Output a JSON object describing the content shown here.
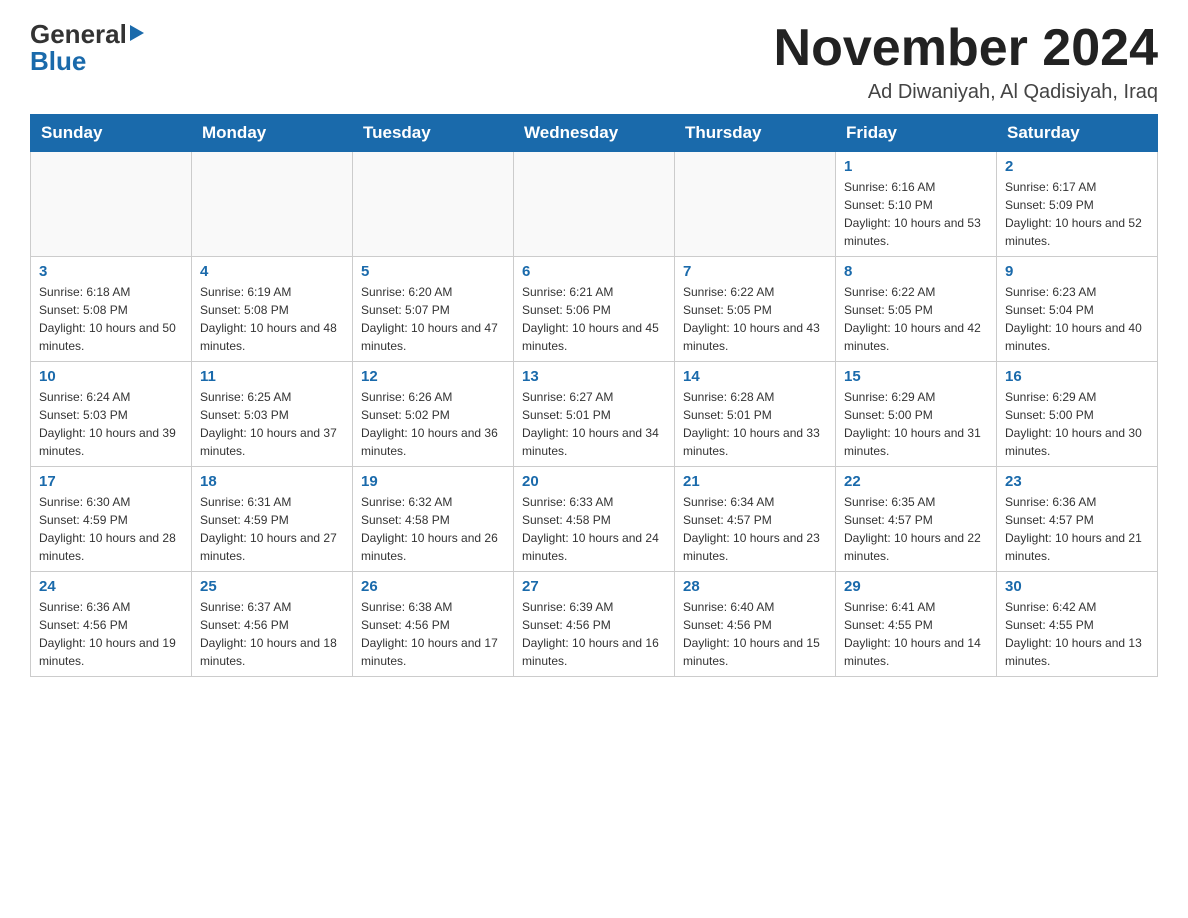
{
  "logo": {
    "general": "General",
    "blue": "Blue",
    "arrow": "▶"
  },
  "title": "November 2024",
  "location": "Ad Diwaniyah, Al Qadisiyah, Iraq",
  "days_of_week": [
    "Sunday",
    "Monday",
    "Tuesday",
    "Wednesday",
    "Thursday",
    "Friday",
    "Saturday"
  ],
  "weeks": [
    [
      {
        "day": "",
        "info": ""
      },
      {
        "day": "",
        "info": ""
      },
      {
        "day": "",
        "info": ""
      },
      {
        "day": "",
        "info": ""
      },
      {
        "day": "",
        "info": ""
      },
      {
        "day": "1",
        "info": "Sunrise: 6:16 AM\nSunset: 5:10 PM\nDaylight: 10 hours and 53 minutes."
      },
      {
        "day": "2",
        "info": "Sunrise: 6:17 AM\nSunset: 5:09 PM\nDaylight: 10 hours and 52 minutes."
      }
    ],
    [
      {
        "day": "3",
        "info": "Sunrise: 6:18 AM\nSunset: 5:08 PM\nDaylight: 10 hours and 50 minutes."
      },
      {
        "day": "4",
        "info": "Sunrise: 6:19 AM\nSunset: 5:08 PM\nDaylight: 10 hours and 48 minutes."
      },
      {
        "day": "5",
        "info": "Sunrise: 6:20 AM\nSunset: 5:07 PM\nDaylight: 10 hours and 47 minutes."
      },
      {
        "day": "6",
        "info": "Sunrise: 6:21 AM\nSunset: 5:06 PM\nDaylight: 10 hours and 45 minutes."
      },
      {
        "day": "7",
        "info": "Sunrise: 6:22 AM\nSunset: 5:05 PM\nDaylight: 10 hours and 43 minutes."
      },
      {
        "day": "8",
        "info": "Sunrise: 6:22 AM\nSunset: 5:05 PM\nDaylight: 10 hours and 42 minutes."
      },
      {
        "day": "9",
        "info": "Sunrise: 6:23 AM\nSunset: 5:04 PM\nDaylight: 10 hours and 40 minutes."
      }
    ],
    [
      {
        "day": "10",
        "info": "Sunrise: 6:24 AM\nSunset: 5:03 PM\nDaylight: 10 hours and 39 minutes."
      },
      {
        "day": "11",
        "info": "Sunrise: 6:25 AM\nSunset: 5:03 PM\nDaylight: 10 hours and 37 minutes."
      },
      {
        "day": "12",
        "info": "Sunrise: 6:26 AM\nSunset: 5:02 PM\nDaylight: 10 hours and 36 minutes."
      },
      {
        "day": "13",
        "info": "Sunrise: 6:27 AM\nSunset: 5:01 PM\nDaylight: 10 hours and 34 minutes."
      },
      {
        "day": "14",
        "info": "Sunrise: 6:28 AM\nSunset: 5:01 PM\nDaylight: 10 hours and 33 minutes."
      },
      {
        "day": "15",
        "info": "Sunrise: 6:29 AM\nSunset: 5:00 PM\nDaylight: 10 hours and 31 minutes."
      },
      {
        "day": "16",
        "info": "Sunrise: 6:29 AM\nSunset: 5:00 PM\nDaylight: 10 hours and 30 minutes."
      }
    ],
    [
      {
        "day": "17",
        "info": "Sunrise: 6:30 AM\nSunset: 4:59 PM\nDaylight: 10 hours and 28 minutes."
      },
      {
        "day": "18",
        "info": "Sunrise: 6:31 AM\nSunset: 4:59 PM\nDaylight: 10 hours and 27 minutes."
      },
      {
        "day": "19",
        "info": "Sunrise: 6:32 AM\nSunset: 4:58 PM\nDaylight: 10 hours and 26 minutes."
      },
      {
        "day": "20",
        "info": "Sunrise: 6:33 AM\nSunset: 4:58 PM\nDaylight: 10 hours and 24 minutes."
      },
      {
        "day": "21",
        "info": "Sunrise: 6:34 AM\nSunset: 4:57 PM\nDaylight: 10 hours and 23 minutes."
      },
      {
        "day": "22",
        "info": "Sunrise: 6:35 AM\nSunset: 4:57 PM\nDaylight: 10 hours and 22 minutes."
      },
      {
        "day": "23",
        "info": "Sunrise: 6:36 AM\nSunset: 4:57 PM\nDaylight: 10 hours and 21 minutes."
      }
    ],
    [
      {
        "day": "24",
        "info": "Sunrise: 6:36 AM\nSunset: 4:56 PM\nDaylight: 10 hours and 19 minutes."
      },
      {
        "day": "25",
        "info": "Sunrise: 6:37 AM\nSunset: 4:56 PM\nDaylight: 10 hours and 18 minutes."
      },
      {
        "day": "26",
        "info": "Sunrise: 6:38 AM\nSunset: 4:56 PM\nDaylight: 10 hours and 17 minutes."
      },
      {
        "day": "27",
        "info": "Sunrise: 6:39 AM\nSunset: 4:56 PM\nDaylight: 10 hours and 16 minutes."
      },
      {
        "day": "28",
        "info": "Sunrise: 6:40 AM\nSunset: 4:56 PM\nDaylight: 10 hours and 15 minutes."
      },
      {
        "day": "29",
        "info": "Sunrise: 6:41 AM\nSunset: 4:55 PM\nDaylight: 10 hours and 14 minutes."
      },
      {
        "day": "30",
        "info": "Sunrise: 6:42 AM\nSunset: 4:55 PM\nDaylight: 10 hours and 13 minutes."
      }
    ]
  ],
  "colors": {
    "header_bg": "#1a6aab",
    "day_num": "#1a6aab"
  }
}
